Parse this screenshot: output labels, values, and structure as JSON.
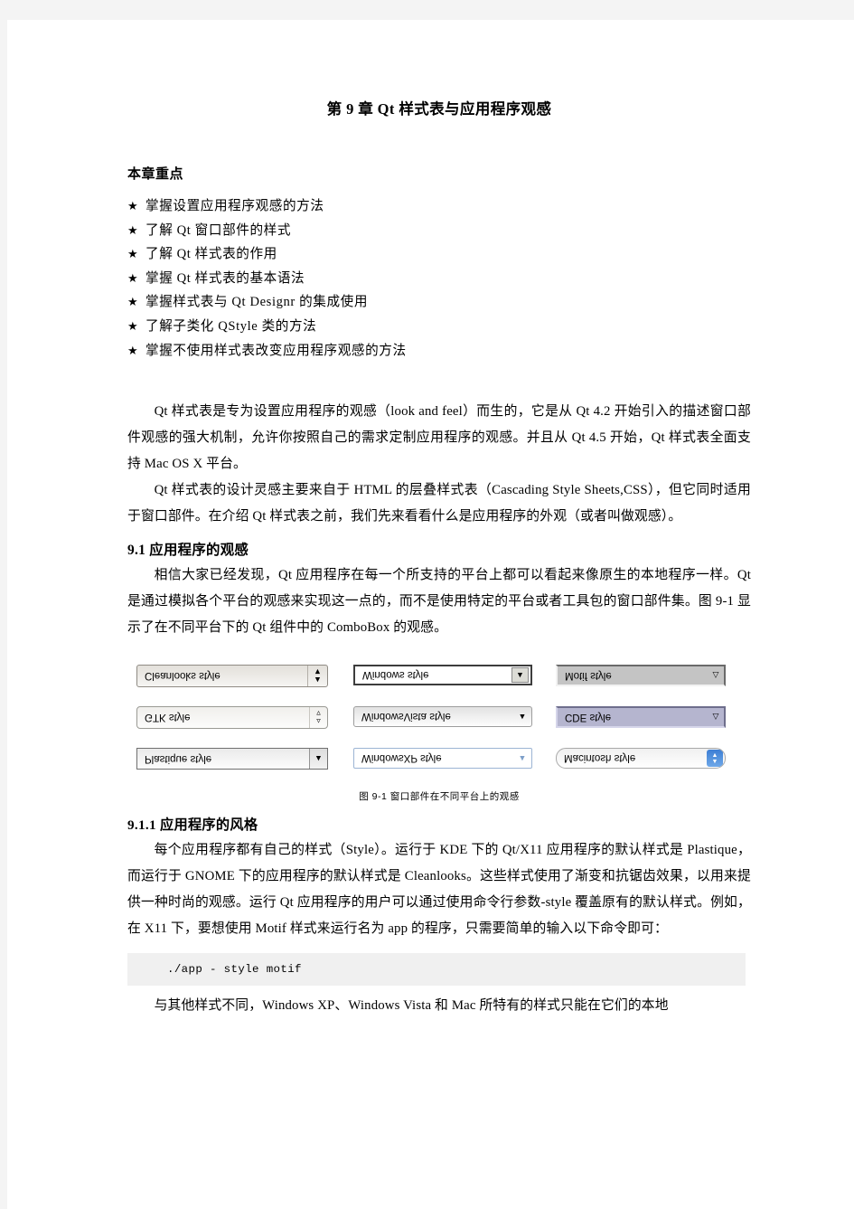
{
  "document": {
    "chapter_title": "第 9 章  Qt 样式表与应用程序观感",
    "keypoints_heading": "本章重点",
    "bullet_star": "★",
    "keypoints": [
      "掌握设置应用程序观感的方法",
      "了解 Qt 窗口部件的样式",
      "了解 Qt 样式表的作用",
      "掌握 Qt 样式表的基本语法",
      "掌握样式表与 Qt Designr 的集成使用",
      "了解子类化 QStyle 类的方法",
      "掌握不使用样式表改变应用程序观感的方法"
    ],
    "intro_paragraph_1": "Qt 样式表是专为设置应用程序的观感（look and feel）而生的，它是从 Qt 4.2 开始引入的描述窗口部件观感的强大机制，允许你按照自己的需求定制应用程序的观感。并且从 Qt 4.5 开始，Qt 样式表全面支持 Mac OS X 平台。",
    "intro_paragraph_2": "Qt 样式表的设计灵感主要来自于 HTML 的层叠样式表（Cascading Style Sheets,CSS），但它同时适用于窗口部件。在介绍 Qt 样式表之前，我们先来看看什么是应用程序的外观（或者叫做观感）。",
    "section_9_1_heading": "9.1 应用程序的观感",
    "section_9_1_paragraph": "相信大家已经发现，Qt 应用程序在每一个所支持的平台上都可以看起来像原生的本地程序一样。Qt 是通过模拟各个平台的观感来实现这一点的，而不是使用特定的平台或者工具包的窗口部件集。图 9-1 显示了在不同平台下的 Qt 组件中的 ComboBox 的观感。",
    "figure": {
      "caption": "图 9-1 窗口部件在不同平台上的观感",
      "combos": [
        {
          "label": "Cleanlooks style",
          "style_key": "cleanlooks",
          "arrow": "updown"
        },
        {
          "label": "Windows style",
          "style_key": "windows",
          "arrow": "up"
        },
        {
          "label": "Motif style",
          "style_key": "motif",
          "arrow": "outline"
        },
        {
          "label": "GTK style",
          "style_key": "gtk",
          "arrow": "updown-thin"
        },
        {
          "label": "WindowsVista style",
          "style_key": "vista",
          "arrow": "up"
        },
        {
          "label": "CDE style",
          "style_key": "cde",
          "arrow": "outline"
        },
        {
          "label": "Plastique style",
          "style_key": "plastique",
          "arrow": "up"
        },
        {
          "label": "WindowsXP style",
          "style_key": "winxp",
          "arrow": "up"
        },
        {
          "label": "Macintosh style",
          "style_key": "mac",
          "arrow": "mac-updown"
        }
      ]
    },
    "section_9_1_1_heading": "9.1.1 应用程序的风格",
    "section_9_1_1_paragraph": "每个应用程序都有自己的样式（Style）。运行于 KDE 下的 Qt/X11 应用程序的默认样式是 Plastique，而运行于 GNOME 下的应用程序的默认样式是 Cleanlooks。这些样式使用了渐变和抗锯齿效果，以用来提供一种时尚的观感。运行 Qt 应用程序的用户可以通过使用命令行参数-style 覆盖原有的默认样式。例如，在 X11 下，要想使用 Motif 样式来运行名为 app 的程序，只需要简单的输入以下命令即可：",
    "code_snippet": "./app  - style motif",
    "final_paragraph": "与其他样式不同，Windows  XP、Windows  Vista 和 Mac 所特有的样式只能在它们的本地"
  }
}
